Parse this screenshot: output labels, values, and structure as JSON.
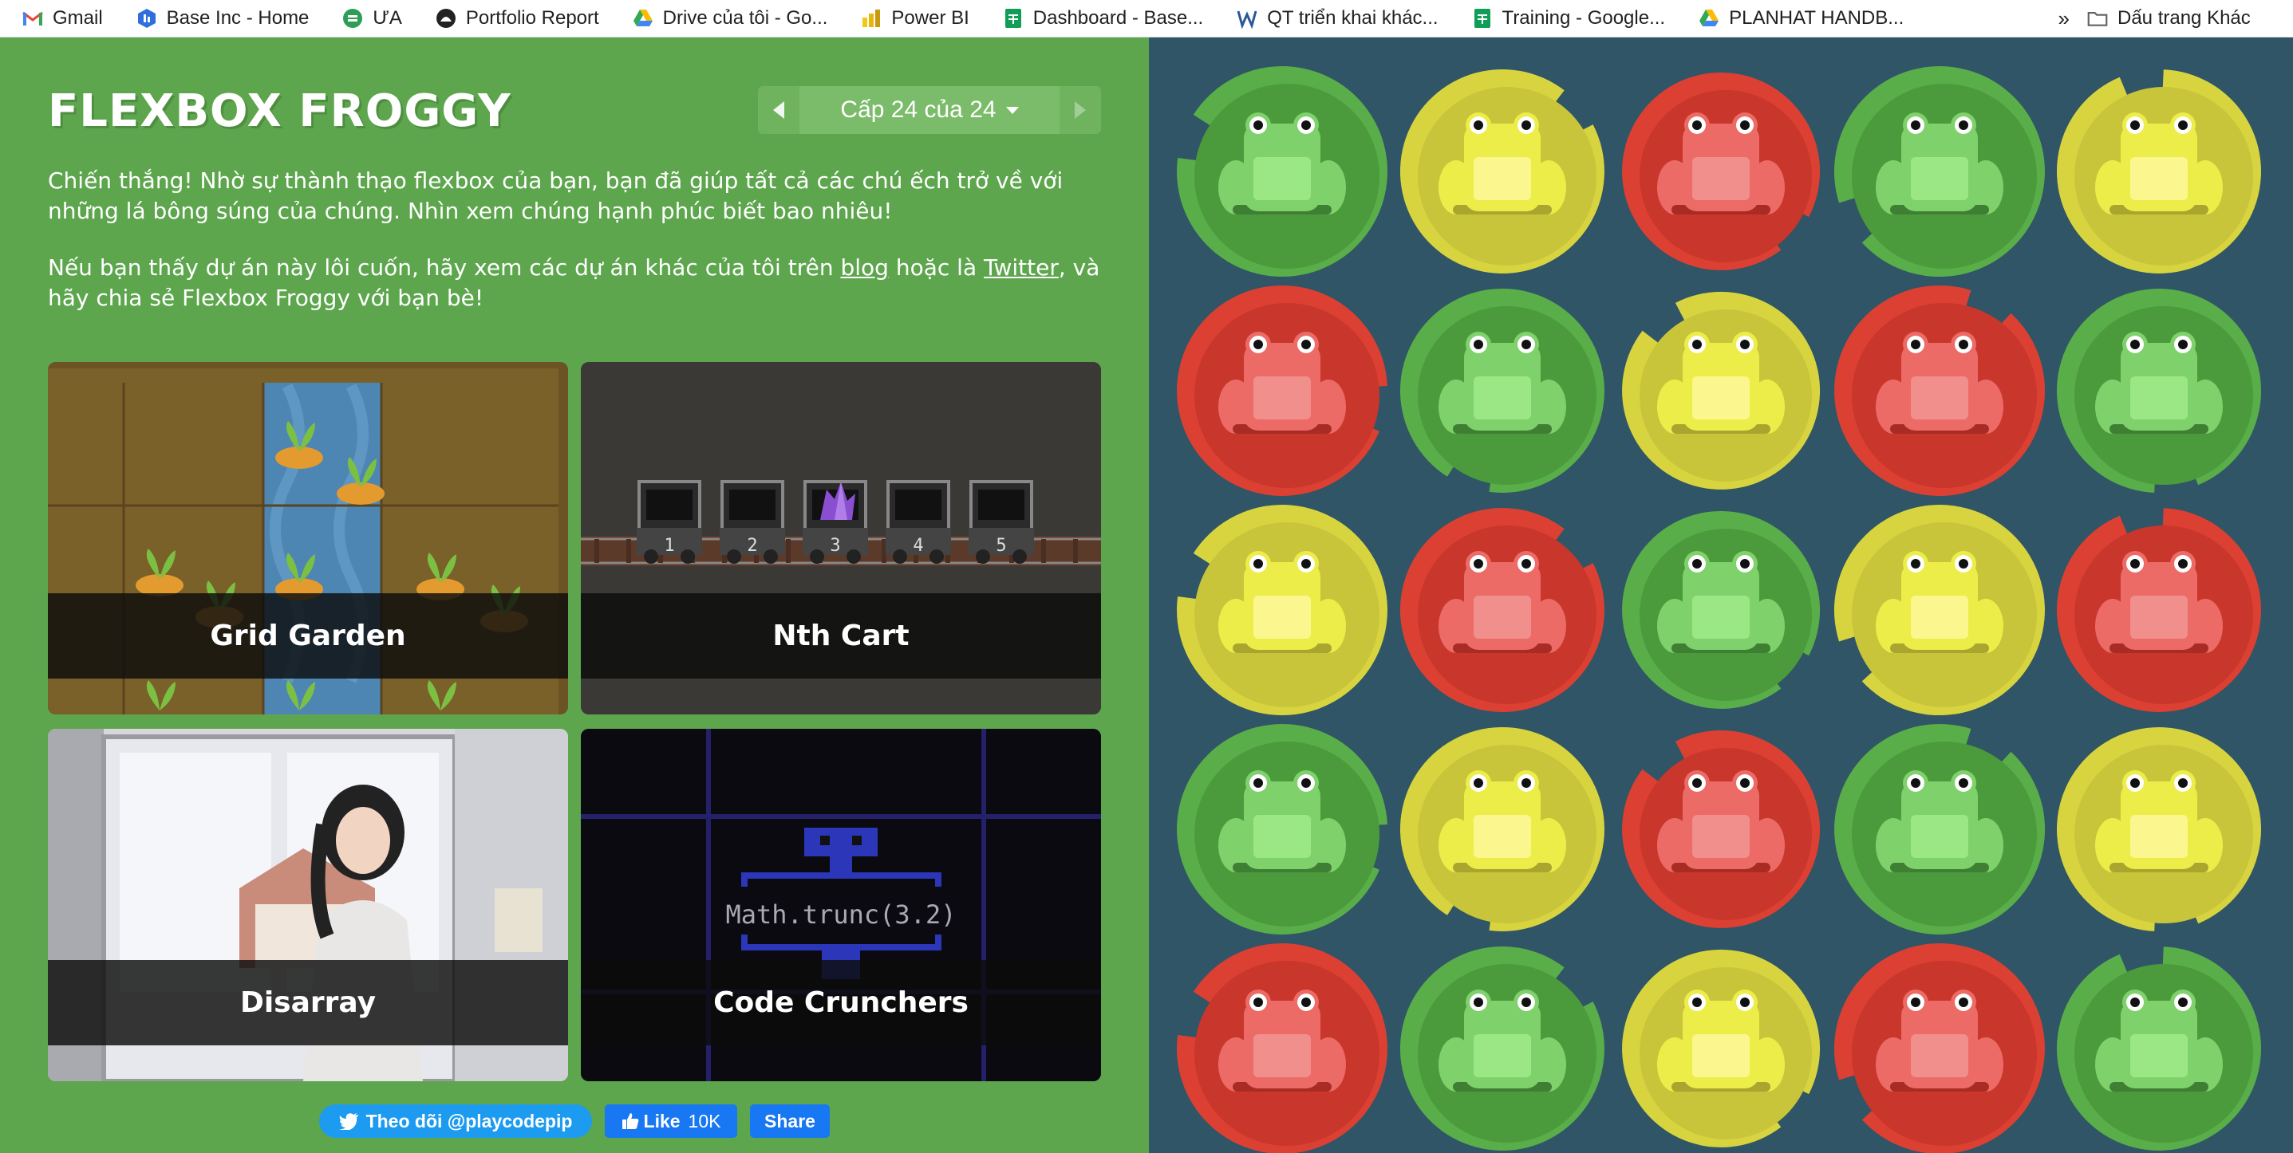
{
  "bookmarks": [
    {
      "label": "Gmail",
      "icon": "gmail-icon"
    },
    {
      "label": "Base Inc - Home",
      "icon": "base-icon"
    },
    {
      "label": "ƯA",
      "icon": "ua-icon"
    },
    {
      "label": "Portfolio Report",
      "icon": "portfolio-icon"
    },
    {
      "label": "Drive của tôi - Go...",
      "icon": "google-drive-icon"
    },
    {
      "label": "Power BI",
      "icon": "power-bi-icon"
    },
    {
      "label": "Dashboard - Base...",
      "icon": "google-sheets-icon"
    },
    {
      "label": "QT triển khai khác...",
      "icon": "word-icon"
    },
    {
      "label": "Training - Google...",
      "icon": "google-sheets-icon"
    },
    {
      "label": "PLANHAT HANDB...",
      "icon": "google-drive-icon"
    }
  ],
  "bookmarks_more": "»",
  "bookmarks_other": "Dấu trang Khác",
  "header": {
    "title": "FLEXBOX FROGGY",
    "level_label": "Cấp 24 của 24"
  },
  "content": {
    "win_message": "Chiến thắng! Nhờ sự thành thạo flexbox của bạn, bạn đã giúp tất cả các chú ếch trở về với những lá bông súng của chúng. Nhìn xem chúng hạnh phúc biết bao nhiêu!",
    "share_before": "Nếu bạn thấy dự án này lôi cuốn, hãy xem các dự án khác của tôi trên ",
    "share_link1": "blog",
    "share_mid": " hoặc là ",
    "share_link2": "Twitter",
    "share_after": ", và hãy chia sẻ Flexbox Froggy với bạn bè!"
  },
  "games": [
    {
      "title": "Grid Garden"
    },
    {
      "title": "Nth Cart",
      "carts": [
        "1",
        "2",
        "3",
        "4",
        "5"
      ]
    },
    {
      "title": "Disarray"
    },
    {
      "title": "Code Crunchers",
      "code": "Math.trunc(3.2)"
    }
  ],
  "social": {
    "twitter_follow": "Theo dõi @playcodepip",
    "fb_like": "Like",
    "fb_like_count": "10K",
    "fb_share": "Share"
  },
  "pond": {
    "rows": [
      [
        "green",
        "yellow",
        "red",
        "green",
        "yellow"
      ],
      [
        "red",
        "green",
        "yellow",
        "red",
        "green"
      ],
      [
        "yellow",
        "red",
        "green",
        "yellow",
        "red"
      ],
      [
        "green",
        "yellow",
        "red",
        "green",
        "yellow"
      ],
      [
        "red",
        "green",
        "yellow",
        "red",
        "green"
      ]
    ],
    "colors": {
      "green": {
        "pad": "#4b9b3c",
        "pad_light": "#5aae49",
        "frog": "#7fd16c",
        "belly": "#9be786",
        "dark": "#3f7f33"
      },
      "yellow": {
        "pad": "#c9c53a",
        "pad_light": "#d8d440",
        "frog": "#eded4a",
        "belly": "#fbf78e",
        "dark": "#aaa52f"
      },
      "red": {
        "pad": "#c9362c",
        "pad_light": "#dc4033",
        "frog": "#ec6b66",
        "belly": "#f08f8b",
        "dark": "#a92c24"
      }
    },
    "background": "#2f5566"
  },
  "colors": {
    "panel": "#5da64d",
    "twitter": "#1d9bf0",
    "facebook": "#1877f2"
  }
}
